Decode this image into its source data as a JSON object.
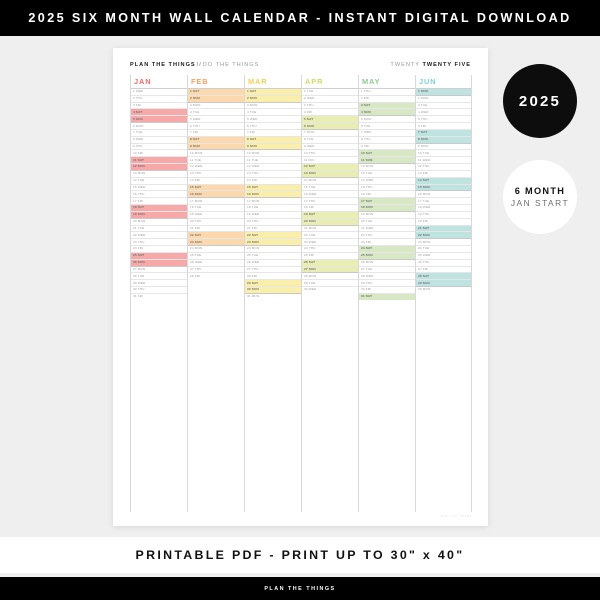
{
  "top_banner": {
    "text": "2025 SIX MONTH WALL CALENDAR - INSTANT DIGITAL DOWNLOAD"
  },
  "bottom_banner": {
    "text": "PRINTABLE PDF - PRINT UP TO 30\" x 40\""
  },
  "footer": {
    "text": "PLAN THE THINGS"
  },
  "badges": {
    "year": "2025",
    "month_count": "6 MONTH",
    "month_start": "JAN START"
  },
  "page": {
    "header_left_strong": "PLAN THE THINGS",
    "header_left_sep": "//",
    "header_left_light": "DO THE THINGS",
    "header_right_light": "TWENTY",
    "header_right_strong": "TWENTY FIVE",
    "watermark": "plan the things"
  },
  "calendar": {
    "year": 2025,
    "weekend_color_note": "weekend pairs (Sat+Sun) filled with the month accent tint",
    "months": [
      {
        "name": "JAN",
        "label_color": "#ef6b68",
        "fill_color": "#f7a9a9",
        "days": 31,
        "first_weekday": "WED",
        "weekend_blocks": [
          [
            4,
            5
          ],
          [
            11,
            12
          ],
          [
            18,
            19
          ],
          [
            25,
            26
          ]
        ]
      },
      {
        "name": "FEB",
        "label_color": "#f4a261",
        "fill_color": "#fbd9ac",
        "days": 28,
        "first_weekday": "SAT",
        "weekend_blocks": [
          [
            1,
            2
          ],
          [
            8,
            9
          ],
          [
            15,
            16
          ],
          [
            22,
            23
          ]
        ]
      },
      {
        "name": "MAR",
        "label_color": "#f2cf5b",
        "fill_color": "#faeeab",
        "days": 31,
        "first_weekday": "SAT",
        "weekend_blocks": [
          [
            1,
            2
          ],
          [
            8,
            9
          ],
          [
            15,
            16
          ],
          [
            22,
            23
          ],
          [
            29,
            30
          ]
        ]
      },
      {
        "name": "APR",
        "label_color": "#cddb6a",
        "fill_color": "#e8eeb3",
        "days": 30,
        "first_weekday": "TUE",
        "weekend_blocks": [
          [
            5,
            6
          ],
          [
            12,
            13
          ],
          [
            19,
            20
          ],
          [
            26,
            27
          ]
        ]
      },
      {
        "name": "MAY",
        "label_color": "#8dc891",
        "fill_color": "#d8e8c4",
        "days": 31,
        "first_weekday": "THU",
        "weekend_blocks": [
          [
            3,
            4
          ],
          [
            10,
            11
          ],
          [
            17,
            18
          ],
          [
            24,
            25
          ],
          [
            31,
            31
          ]
        ]
      },
      {
        "name": "JUN",
        "label_color": "#7fd3d5",
        "fill_color": "#bfe3e1",
        "days": 30,
        "first_weekday": "SUN",
        "weekend_blocks": [
          [
            1,
            1
          ],
          [
            7,
            8
          ],
          [
            14,
            15
          ],
          [
            21,
            22
          ],
          [
            28,
            29
          ]
        ]
      }
    ],
    "weekday_abbr": [
      "SUN",
      "MON",
      "TUE",
      "WED",
      "THU",
      "FRI",
      "SAT"
    ]
  }
}
